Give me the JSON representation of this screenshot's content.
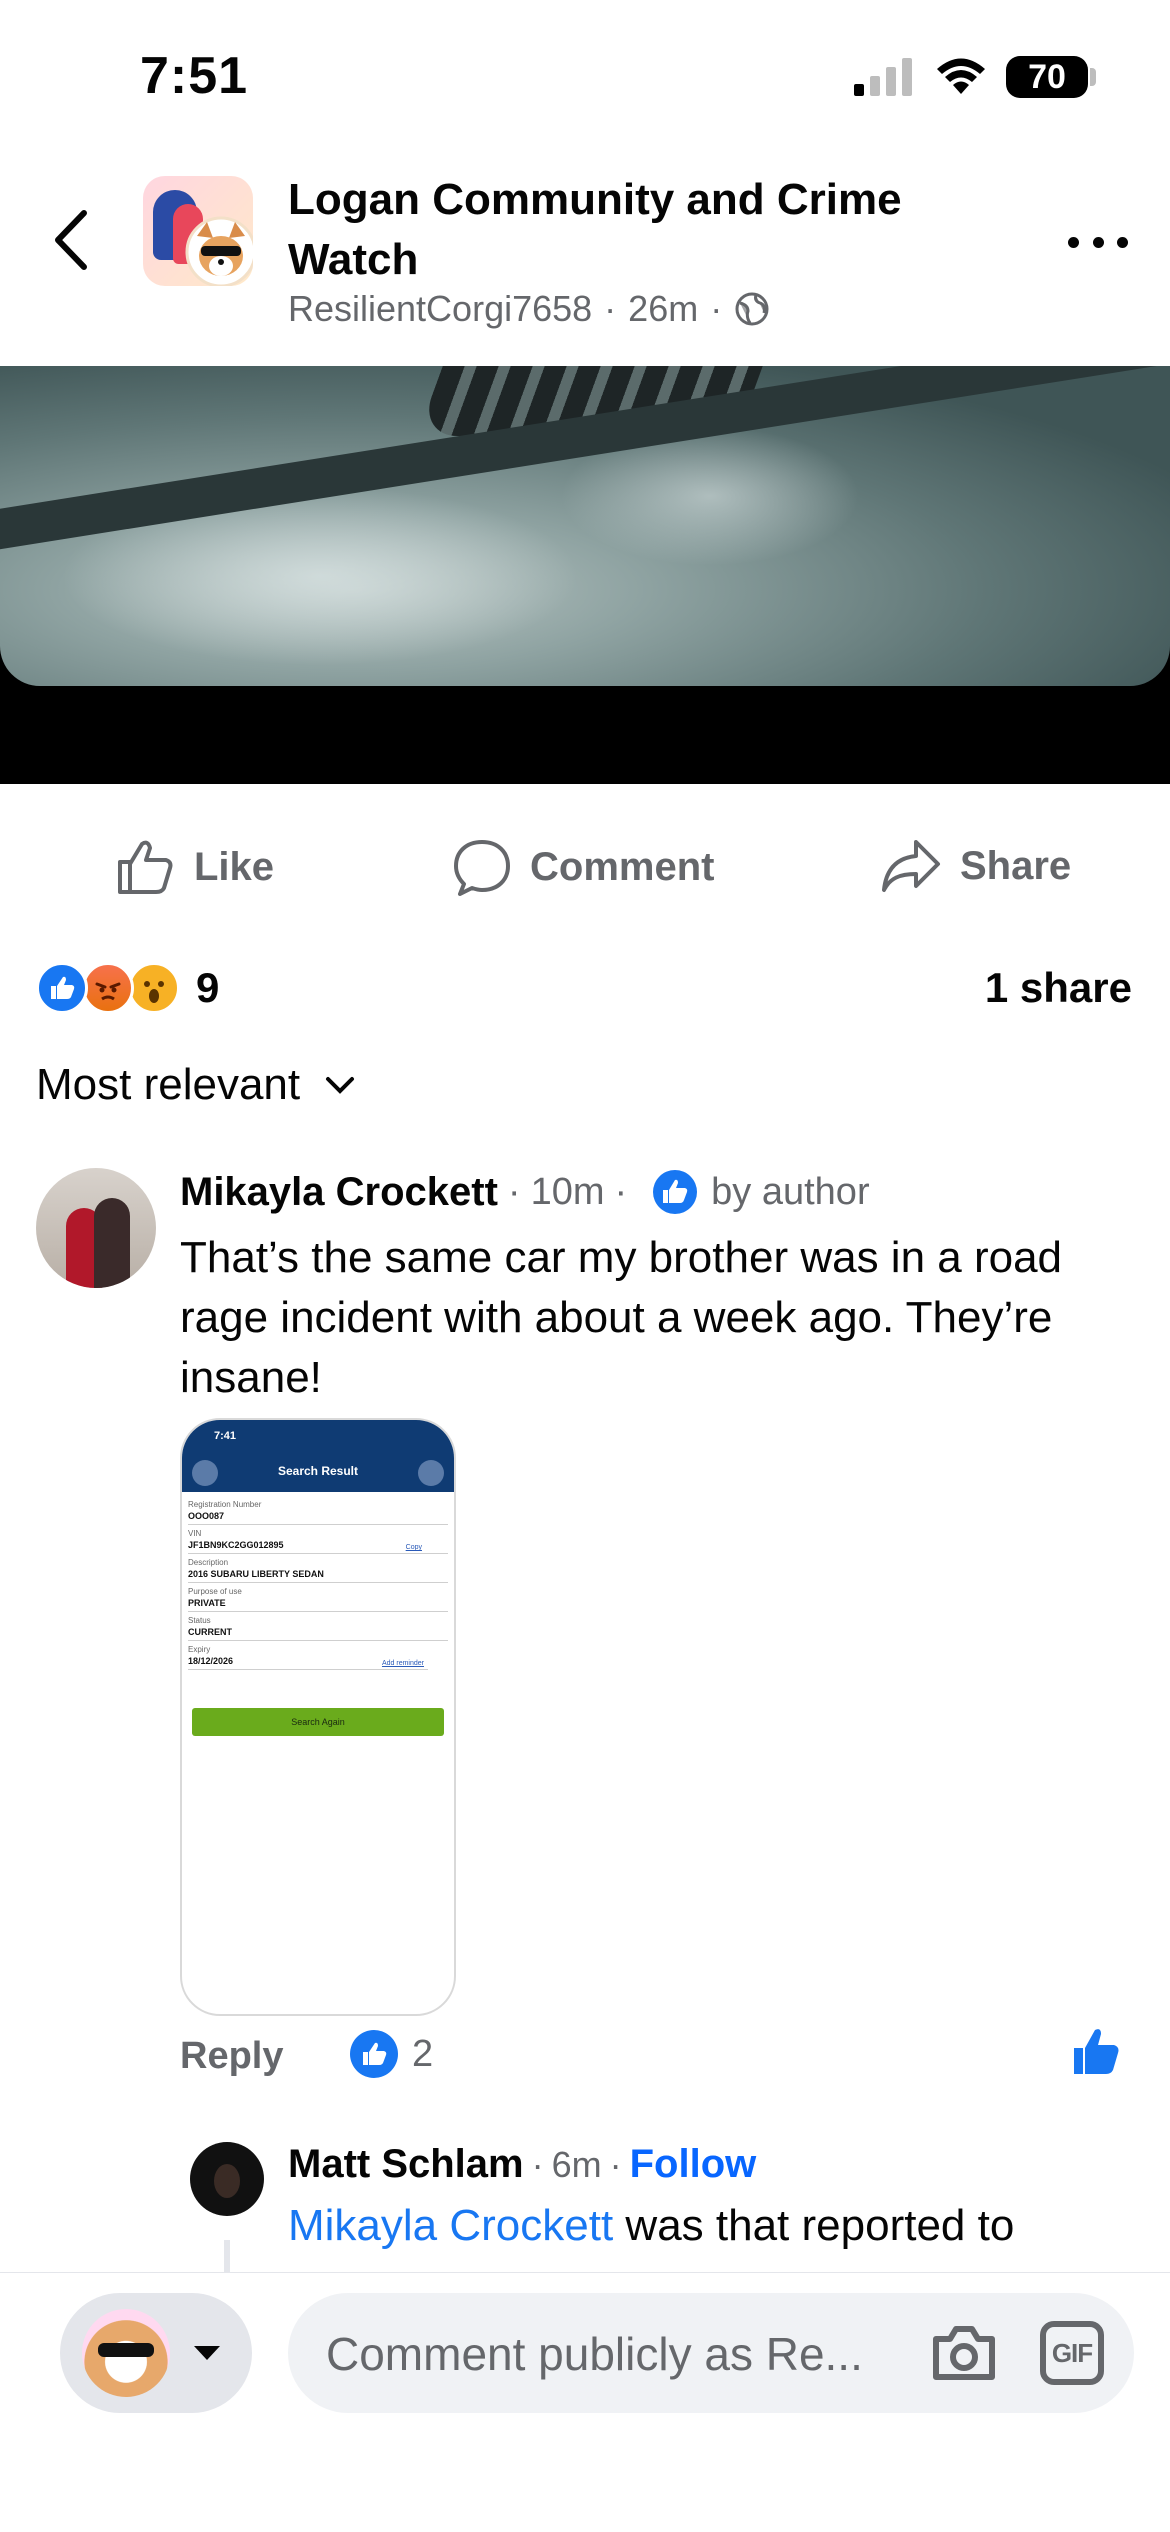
{
  "status": {
    "time": "7:51",
    "battery": "70"
  },
  "header": {
    "title": "Logan Community and Crime Watch",
    "author": "ResilientCorgi7658",
    "time": "26m"
  },
  "actions": {
    "like": "Like",
    "comment": "Comment",
    "share": "Share"
  },
  "reactions": {
    "count": "9",
    "shares": "1 share"
  },
  "sort": {
    "label": "Most relevant"
  },
  "comment": {
    "name": "Mikayla Crockett",
    "time": "10m",
    "badge": "by author",
    "text": "That’s the same car my brother was in a road rage incident with about a week ago. They’re insane!",
    "reply_label": "Reply",
    "like_count": "2",
    "attachment": {
      "time": "7:41",
      "title": "Search Result",
      "fields": [
        {
          "label": "Registration Number",
          "value": "OOO087"
        },
        {
          "label": "VIN",
          "value": "JF1BN9KC2GG012895",
          "link": "Copy"
        },
        {
          "label": "Description",
          "value": "2016 SUBARU LIBERTY SEDAN"
        },
        {
          "label": "Purpose of use",
          "value": "PRIVATE"
        },
        {
          "label": "Status",
          "value": "CURRENT"
        },
        {
          "label": "Expiry",
          "value": "18/12/2026",
          "link": "Add reminder"
        }
      ],
      "button": "Search Again"
    }
  },
  "reply": {
    "name": "Matt Schlam",
    "time": "6m",
    "follow": "Follow",
    "mention": "Mikayla Crockett",
    "text": " was that reported to"
  },
  "composer": {
    "placeholder": "Comment publicly as Re..."
  },
  "colors": {
    "brand_blue": "#1877f2",
    "text_secondary": "#65676b",
    "link_blue": "#0866ff"
  }
}
